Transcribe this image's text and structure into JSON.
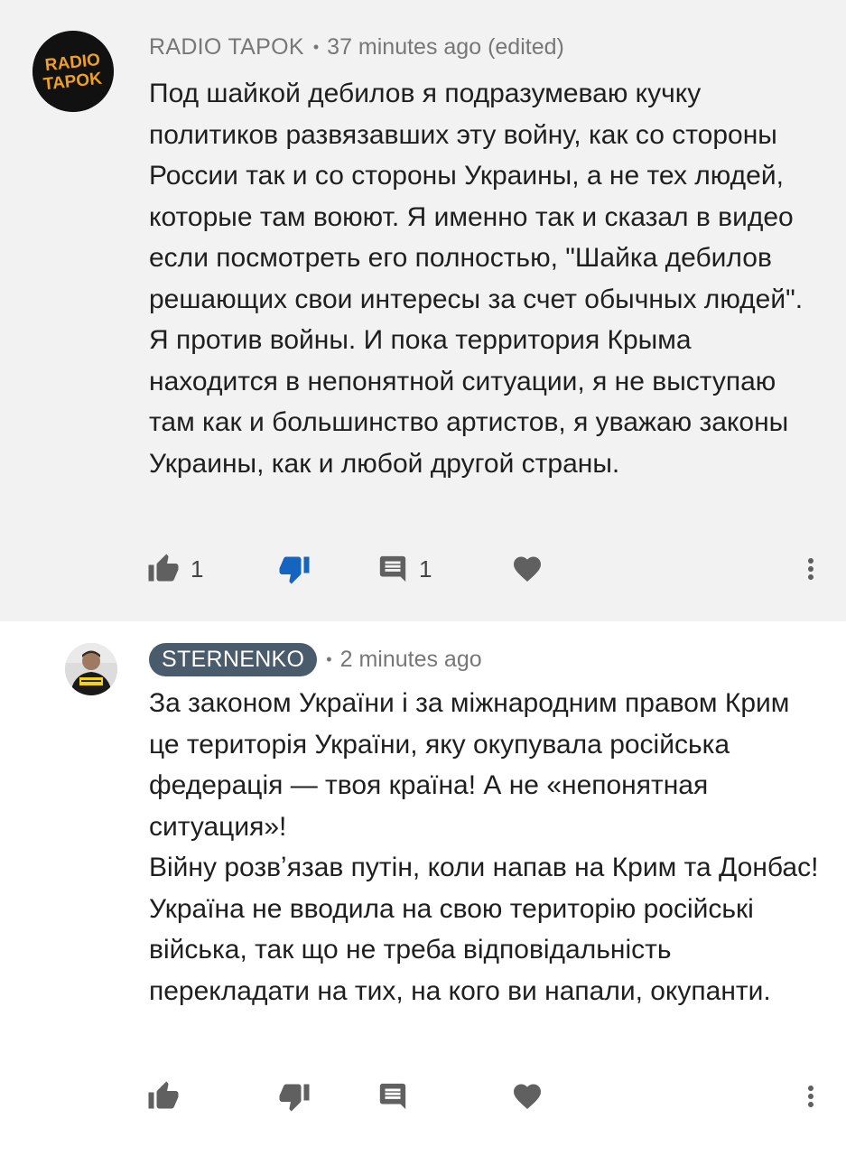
{
  "comments": [
    {
      "author": "RADIO TAPOK",
      "time": "37 minutes ago (edited)",
      "avatar_lines": [
        "RADIO",
        "TAPOK"
      ],
      "paragraphs": [
        "Под шайкой дебилов я подразумеваю кучку политиков развязавших эту войну, как со стороны России так и со стороны Украины, а не тех людей, которые там воюют. Я именно так и сказал в видео если посмотреть его полностью, \"Шайка дебилов решающих свои интересы за счет обычных людей\". Я против войны. И пока территория Крыма находится в непонятной ситуации, я не выступаю там как и большинство артистов, я уважаю законы Украины, как и любой другой страны."
      ],
      "likes": "1",
      "replies": "1",
      "disliked": true
    },
    {
      "author": "STERNENKO",
      "time": "2 minutes ago",
      "paragraphs": [
        "За законом України і за міжнародним правом Крим це територія України, яку окупувала російська федерація — твоя країна! А не «непонятная ситуация»!",
        "Війну розвʼязав путін, коли напав на Крим та Донбас! Україна не вводила на свою територію російські війська, так що не треба відповідальність перекладати на тих, на кого ви напали, окупанти."
      ]
    }
  ],
  "icons": {
    "like": "thumbs-up-icon",
    "dislike": "thumbs-down-icon",
    "reply": "comment-icon",
    "heart": "heart-icon",
    "menu": "more-vert-icon"
  },
  "colors": {
    "chip_bg": "#4a5b6b",
    "dislike_active": "#1565c0",
    "icon_gray": "#606060"
  }
}
